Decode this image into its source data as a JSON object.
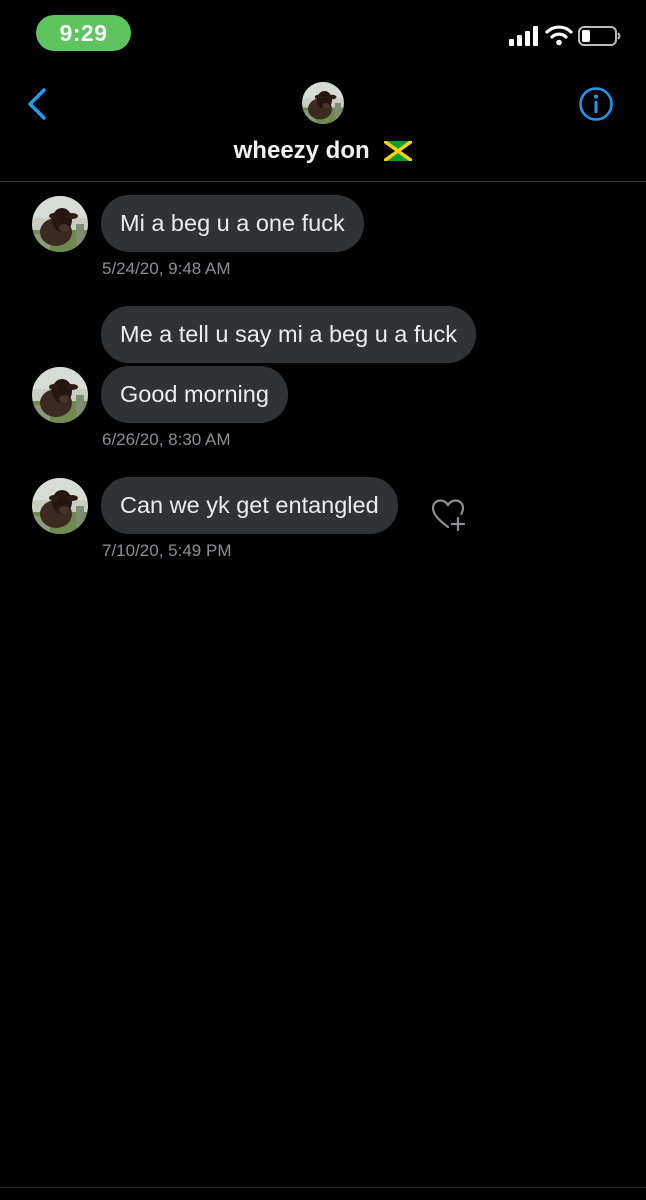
{
  "status_bar": {
    "time": "9:29",
    "time_pill_color": "#5ec460"
  },
  "header": {
    "contact_name": "wheezy don",
    "flag_icon": "jamaica-flag-icon",
    "back_icon": "chevron-left-icon",
    "info_icon": "info-circle-icon",
    "accent_color": "#1d9bf0"
  },
  "messages": [
    {
      "text": "Mi a beg u a one fuck",
      "timestamp": "5/24/20, 9:48 AM"
    },
    {
      "text": "Me a tell u say mi a beg u a fuck"
    },
    {
      "text": "Good morning",
      "timestamp": "6/26/20, 8:30 AM"
    },
    {
      "text": "Can we yk get entangled",
      "timestamp": "7/10/20, 5:49 PM"
    }
  ],
  "colors": {
    "background": "#000000",
    "bubble": "#2f3336",
    "timestamp": "#8b8f94"
  }
}
